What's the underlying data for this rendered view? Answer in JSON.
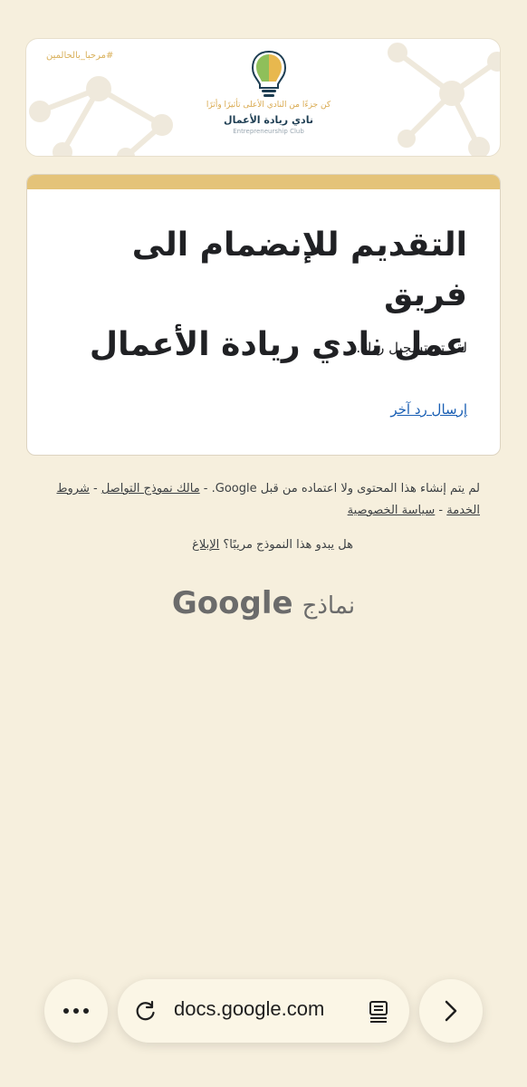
{
  "banner": {
    "hashtag": "#مرحبا_بالحالمين",
    "slogan": "كن جزءًا من النادي الأعلى تأثيرًا وأثرًا",
    "club_name_ar": "نادي ريادة الأعمال",
    "club_name_en": "Entrepreneurship Club",
    "colors": {
      "gold": "#d9b05a",
      "navy": "#1d3d52",
      "green": "#8fbf5a"
    }
  },
  "card": {
    "title_line1": "التقديم للإنضمام الى فريق",
    "title_line2": "عمل نادي ريادة الأعمال",
    "message": "لقد تم تسجيل ردك.",
    "link_label": "إرسال رد آخر",
    "accent": "#e4c379"
  },
  "footer": {
    "notice_text": "لم يتم إنشاء هذا المحتوى ولا اعتماده من قبل Google. - ",
    "owner_link": "مالك نموذج التواصل",
    "terms_link": "شروط الخدمة",
    "privacy_link": "سياسة الخصوصية",
    "separator": " - ",
    "report_question": "هل يبدو هذا النموذج مريبًا؟ ",
    "report_link": "الإبلاغ",
    "brand_google": "Google",
    "brand_forms": "نماذج"
  },
  "browser": {
    "url": "docs.google.com",
    "icons": [
      "more-icon",
      "reload-icon",
      "reader-mode-icon",
      "forward-icon"
    ]
  }
}
